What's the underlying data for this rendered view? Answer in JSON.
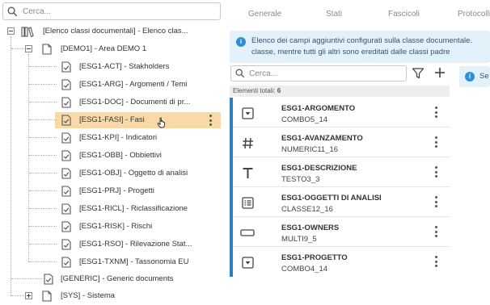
{
  "tree": {
    "search_placeholder": "Cerca...",
    "root": "[Elenco classi documentali] - Elenco clas...",
    "demo": "[DEMO1] - Area DEMO 1",
    "items": [
      "[ESG1-ACT] - Stakholders",
      "[ESG1-ARG] - Argomenti / Temi",
      "[ESG1-DOC] - Documenti di pr...",
      "[ESG1-FASI] - Fasi",
      "[ESG1-KPI] - Indicatori",
      "[ESG1-OBB] - Obbiettivi",
      "[ESG1-OBJ] - Oggetto di analisi",
      "[ESG1-PRJ] - Progetti",
      "[ESG1-RICL] - Riclassificazione",
      "[ESG1-RISK] - Rischi",
      "[ESG1-RSO] - Rilevazione Stat...",
      "[ESG1-TXNM] - Tassonomia EU"
    ],
    "generic": "[GENERIC] - Generic documents",
    "sys": "[SYS] - Sistema"
  },
  "tabs": [
    "Generale",
    "Stati",
    "Fascicoli",
    "Protocolli"
  ],
  "info": {
    "line1": "Elenco dei campi aggiuntivi configurati sulla classe documentale.",
    "line2": "classe, mentre tutti gli altri sono ereditati dalle classi padre",
    "side_text": "Se"
  },
  "fields": {
    "search_placeholder": "Cerca...",
    "count_label": "Elementi totali:",
    "count_value": "6",
    "items": [
      {
        "name": "ESG1-ARGOMENTO",
        "type": "COMBO5_14",
        "icon": "combo-icon"
      },
      {
        "name": "ESG1-AVANZAMENTO",
        "type": "NUMERIC11_16",
        "icon": "hash-icon"
      },
      {
        "name": "ESG1-DESCRIZIONE",
        "type": "TESTO3_3",
        "icon": "text-icon"
      },
      {
        "name": "ESG1-OGGETTI DI ANALISI",
        "type": "CLASSE12_16",
        "icon": "list-icon"
      },
      {
        "name": "ESG1-OWNERS",
        "type": "MULTI9_5",
        "icon": "multi-icon"
      },
      {
        "name": "ESG1-PROGETTO",
        "type": "COMBO4_14",
        "icon": "combo-icon"
      }
    ]
  },
  "colors": {
    "selection": "#f9d9a8",
    "accent": "#2d7fc1",
    "info_bg": "#e3f1fb"
  }
}
